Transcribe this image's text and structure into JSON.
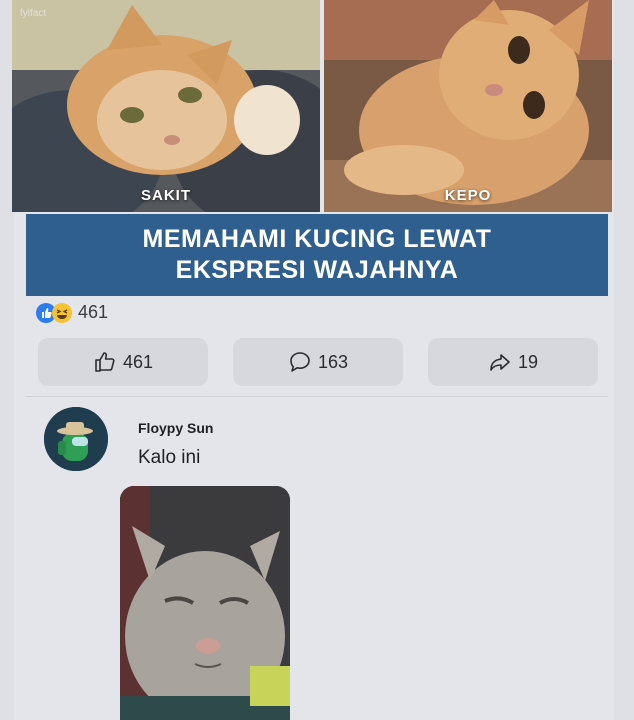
{
  "post": {
    "watermark": "fylfact",
    "panels": [
      {
        "caption": "SAKIT"
      },
      {
        "caption": "KEPO"
      }
    ],
    "banner": {
      "line1": "MEMAHAMI KUCING LEWAT",
      "line2": "EKSPRESI WAJAHNYA"
    },
    "reaction_count": "461",
    "reaction_icons": [
      "like-icon",
      "haha-icon"
    ]
  },
  "actions": {
    "like": {
      "icon": "thumbs-up-icon",
      "count": "461"
    },
    "comment": {
      "icon": "comment-bubble-icon",
      "count": "163"
    },
    "share": {
      "icon": "share-arrow-icon",
      "count": "19"
    }
  },
  "comment": {
    "author": "Floypy Sun",
    "text": "Kalo ini"
  },
  "colors": {
    "banner": "#2f5f8f",
    "background": "#e4e5ea",
    "like": "#2d7cf0",
    "haha": "#f5c233"
  }
}
